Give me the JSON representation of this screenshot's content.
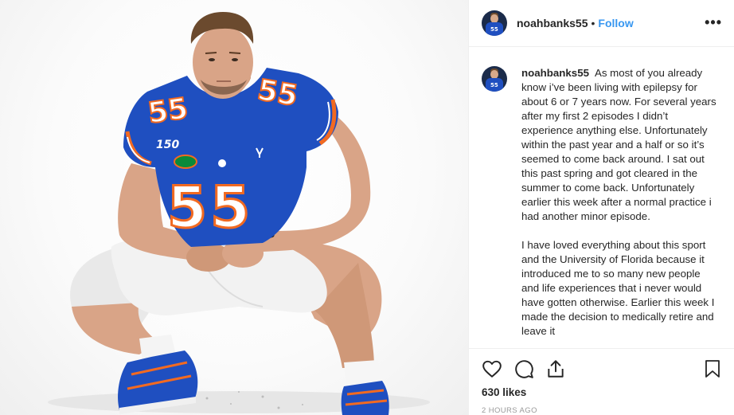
{
  "post": {
    "username": "noahbanks55",
    "separator": "•",
    "follow_label": "Follow",
    "more_label": "•••",
    "jersey_number": "55",
    "patch_text": "150",
    "avatar_jersey_number": "55"
  },
  "caption": {
    "username": "noahbanks55",
    "paragraph_1": "As most of you already know i’ve been living with epilepsy for about 6 or 7 years now. For several years after my first 2 episodes I didn’t experience anything else. Unfortunately within the past year and a half or so it’s seemed to come back around. I sat out this past spring and got cleared in the summer to come back. Unfortunately earlier this week after a normal practice i had another minor episode.",
    "paragraph_2": "I have loved everything about this sport and the University of Florida because it introduced me to so many new people and life experiences that i never would have gotten otherwise. Earlier this week I made the decision to medically retire and leave it"
  },
  "actions": {
    "icons": [
      "heart-icon",
      "comment-icon",
      "share-icon",
      "bookmark-icon"
    ],
    "likes": "630 likes",
    "timestamp": "2 HOURS AGO"
  },
  "colors": {
    "jersey_blue": "#1f4fc0",
    "jersey_orange": "#f26a21",
    "follow_blue": "#3897f0",
    "text": "#262626",
    "muted": "#999999",
    "border": "#efefef"
  }
}
